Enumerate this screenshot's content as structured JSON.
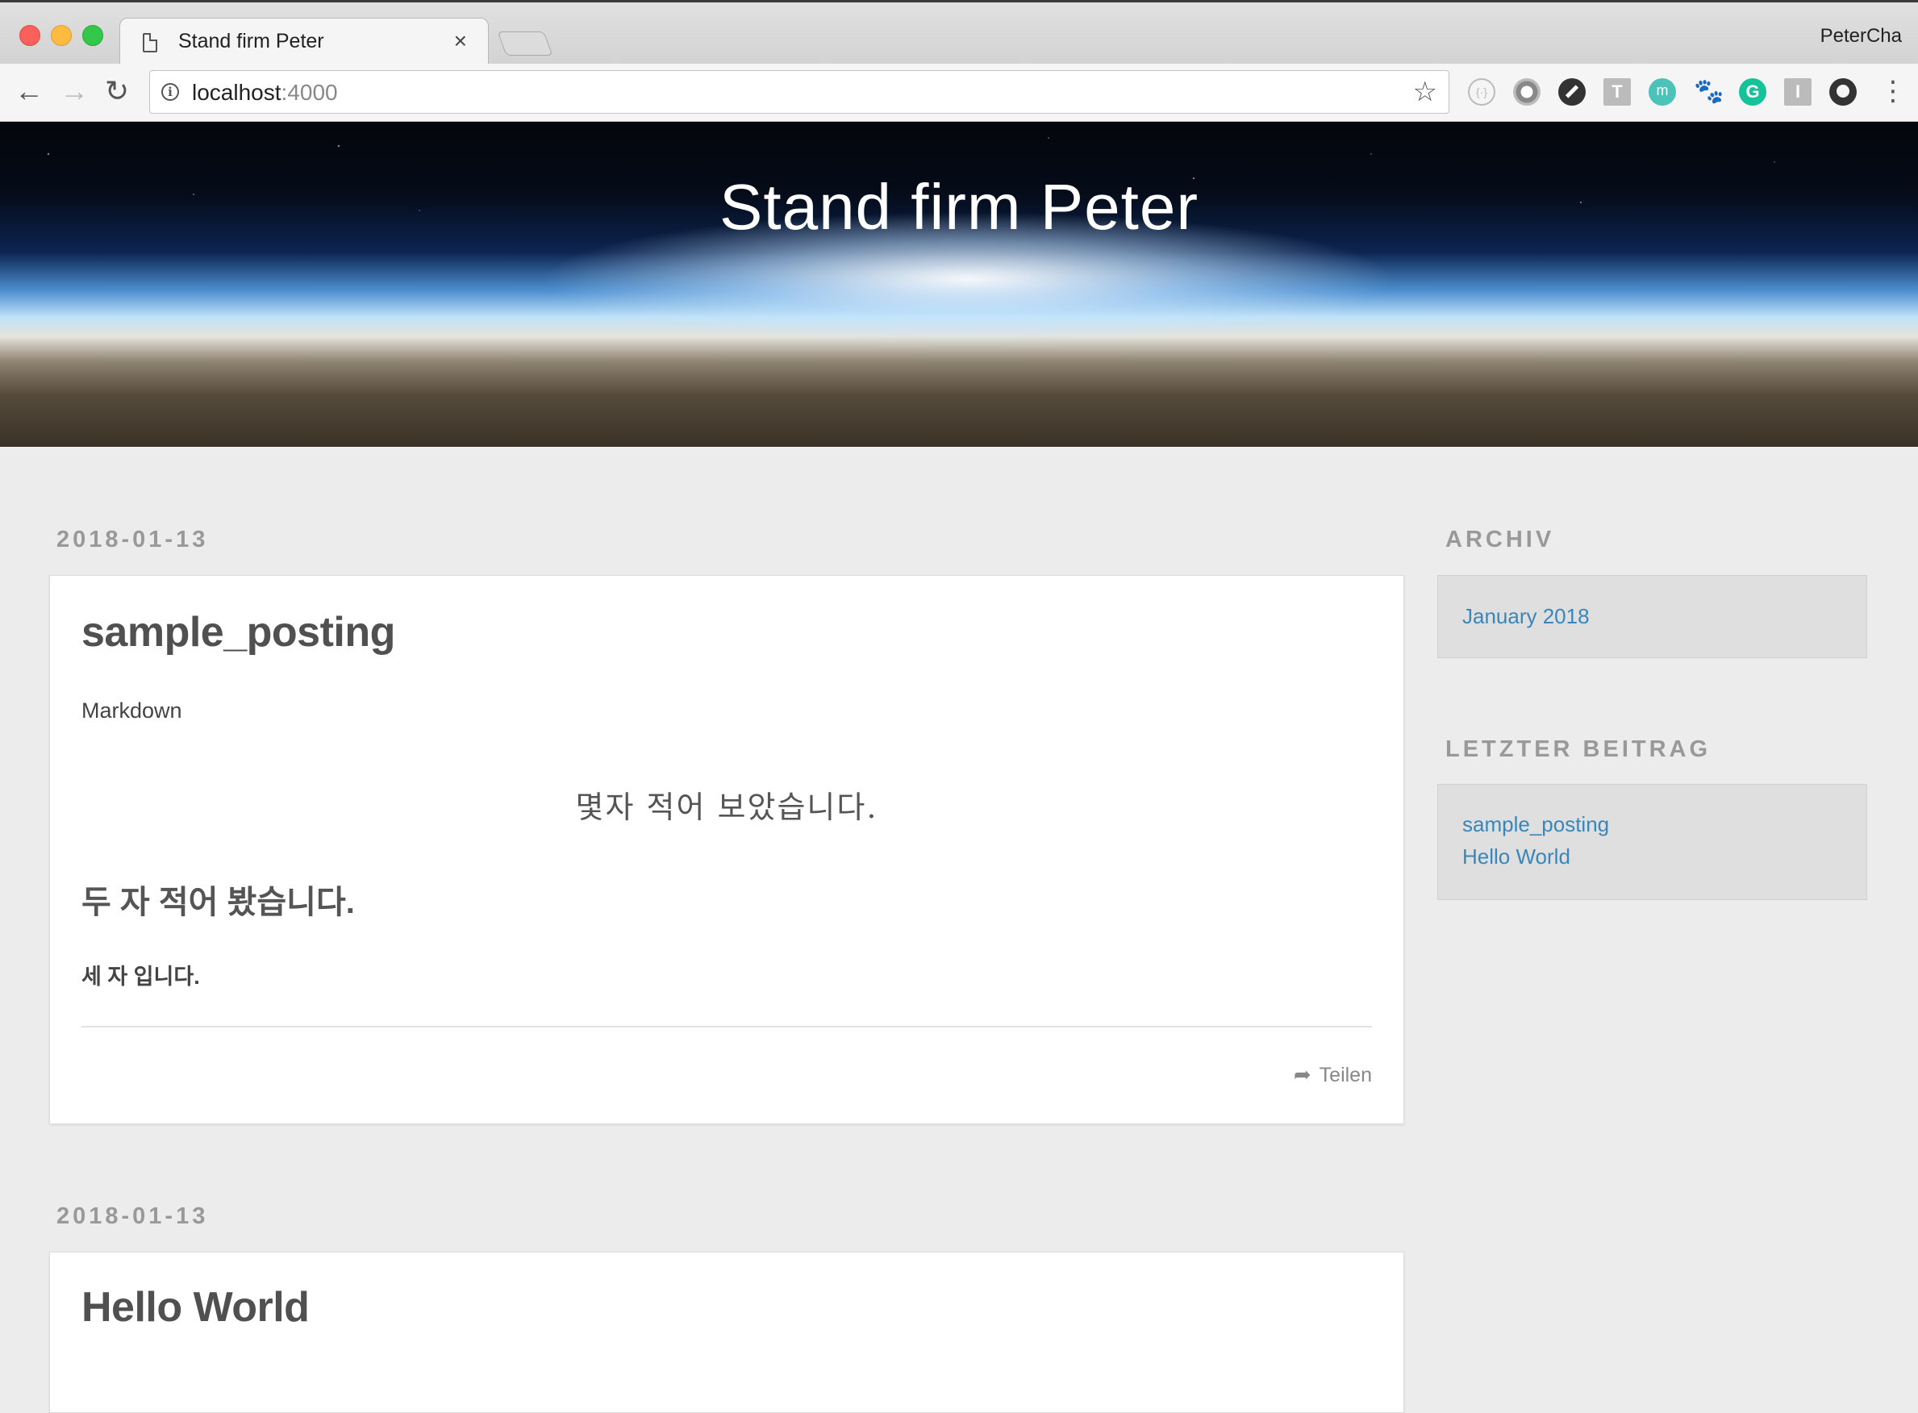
{
  "browser": {
    "tab_title": "Stand firm Peter",
    "tab_close": "×",
    "profile_name": "PeterCha",
    "nav": {
      "back": "←",
      "forward": "→",
      "reload": "↻",
      "menu": "⋮"
    },
    "url_host": "localhost",
    "url_port": ":4000",
    "info_glyph": "i",
    "star": "☆",
    "extensions": [
      {
        "name": "braces-extension-icon",
        "glyph": "{·}"
      },
      {
        "name": "gear-extension-icon",
        "glyph": ""
      },
      {
        "name": "blocker-extension-icon",
        "glyph": ""
      },
      {
        "name": "t-extension-icon",
        "glyph": "T"
      },
      {
        "name": "m-extension-icon",
        "glyph": "m"
      },
      {
        "name": "gnome-extension-icon",
        "glyph": "🐾"
      },
      {
        "name": "grammarly-extension-icon",
        "glyph": "G"
      },
      {
        "name": "i-extension-icon",
        "glyph": "I"
      },
      {
        "name": "github-extension-icon",
        "glyph": ""
      }
    ]
  },
  "header": {
    "site_title": "Stand firm Peter"
  },
  "posts": [
    {
      "date": "2018-01-13",
      "title": "sample_posting",
      "paragraph": "Markdown",
      "center_text": "몇자 적어 보았습니다.",
      "h2": "두 자 적어 봤습니다.",
      "h4": "세 자 입니다.",
      "share_icon": "➦",
      "share_label": "Teilen"
    },
    {
      "date": "2018-01-13",
      "title": "Hello World"
    }
  ],
  "sidebar": {
    "archive_heading": "ARCHIV",
    "archive_items": [
      "January 2018"
    ],
    "recent_heading": "LETZTER BEITRAG",
    "recent_items": [
      "sample_posting",
      "Hello World"
    ]
  },
  "colors": {
    "page_background": "#ececec",
    "link": "#3a86b8",
    "muted_heading": "#999999"
  }
}
